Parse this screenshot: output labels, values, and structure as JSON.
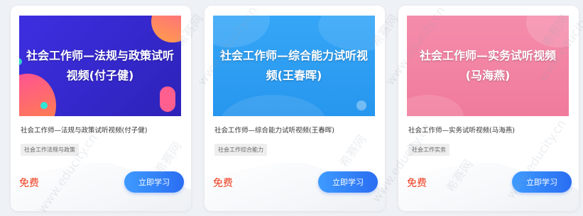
{
  "cards": [
    {
      "thumb_title": "社会工作师—法规与政策试听视频(付子健)",
      "title": "社会工作师—法规与政策试听视频(付子健)",
      "tag": "社会工作法规与政策",
      "price": "免费",
      "button": "立即学习",
      "thumb_color": "#3a2fd6"
    },
    {
      "thumb_title": "社会工作师—综合能力试听视频(王春晖)",
      "title": "社会工作师—综合能力试听视频(王春晖)",
      "tag": "社会工作综合能力",
      "price": "免费",
      "button": "立即学习",
      "thumb_color": "#2b9cf2"
    },
    {
      "thumb_title": "社会工作师—实务试听视频(马海燕)",
      "title": "社会工作师—实务试听视频(马海燕)",
      "tag": "社会工作实务",
      "price": "免费",
      "button": "立即学习",
      "thumb_color": "#f27fa0"
    }
  ],
  "watermark": {
    "brand": "希赛网",
    "url": "www.educity.cn"
  },
  "colors": {
    "price": "#ee3b1a",
    "button": "#2a6df2"
  }
}
